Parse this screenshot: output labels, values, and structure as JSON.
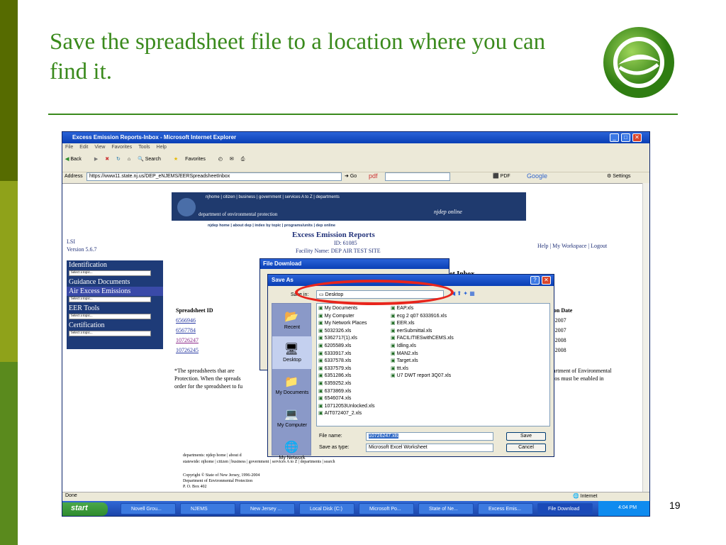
{
  "slide": {
    "title": "Save the spreadsheet file to a location where you can find it.",
    "number": "19"
  },
  "ie": {
    "title": "Excess Emission Reports-Inbox - Microsoft Internet Explorer",
    "menu": [
      "File",
      "Edit",
      "View",
      "Favorites",
      "Tools",
      "Help"
    ],
    "toolbar": {
      "back": "Back",
      "search": "Search",
      "favorites": "Favorites",
      "go": "Go",
      "pdf": "pdf",
      "pdf2": "PDF",
      "google": "Google",
      "settings": "Settings"
    },
    "address_label": "Address",
    "address": "https://www11.state.nj.us/DEP_eNJEMS/EERSpreadsheetInbox",
    "status": "Done",
    "zone": "Internet"
  },
  "taskbar": {
    "start": "start",
    "items": [
      "Novell Grou...",
      "NJEMS",
      "New Jersey ...",
      "Local Disk (C:)",
      "Microsoft Po...",
      "State of Ne...",
      "Excess Emis...",
      "File Download"
    ],
    "clock": "4:04 PM"
  },
  "page": {
    "banner_nav": "njhome  |  citizen  |  business  |  government  |  services A to Z  |  departments",
    "banner_dept": "department of environmental protection",
    "banner_brand": "njdep online",
    "banner_nav2": "njdep home  |  about dep  |  index by topic  |  programs/units  |  dep online",
    "heading": "Excess Emission Reports",
    "id": "ID: 61085",
    "facility": "Facility Name: DEP AIR TEST SITE",
    "lsi": "LSI",
    "version": "Version 5.6.7",
    "toplinks": "Help | My Workspace | Logout",
    "side": {
      "identification": "Identification",
      "guidance": "Guidance Documents",
      "air": "Air Excess Emissions",
      "eer": "EER Tools",
      "cert": "Certification",
      "select": "Select a topic..."
    },
    "col_spreadsheet": "Spreadsheet ID",
    "col_date": "tion Date",
    "ids": [
      "6566946",
      "6567784",
      "10726247",
      "10726245"
    ],
    "dates": [
      "0-2007",
      "0-2007",
      "8-2008",
      "8-2008"
    ],
    "inbox_frag": "et Inbox",
    "note1": "*The spreadsheets that are",
    "note2": "Protection. When the spreads",
    "note3": "order for the spreadsheet to fu",
    "note_r1": "partment of Environmental",
    "note_r2": "cros must be enabled in",
    "footer1": "departments: njdep home | about d",
    "footer2": "statewide: njhome | citizen | business | government | services A to Z | departments | search",
    "copyright1": "Copyright © State of New Jersey, 1996-2004",
    "copyright2": "Department of Environmental Protection",
    "copyright3": "P. O. Box 402"
  },
  "file_download": {
    "title": "File Download"
  },
  "save_as": {
    "title": "Save As",
    "save_in_label": "Save in:",
    "save_in": "Desktop",
    "places": [
      "Recent",
      "Desktop",
      "My Documents",
      "My Computer",
      "My Network"
    ],
    "col1": [
      "My Documents",
      "My Computer",
      "My Network Places",
      "5032326.xls",
      "5362717(1).xls",
      "6205589.xls",
      "6333917.xls",
      "6337578.xls",
      "6337579.xls",
      "6351286.xls",
      "6359252.xls",
      "6373869.xls",
      "6546074.xls",
      "10712053Unlocked.xls",
      "AIT072407_2.xls"
    ],
    "col2": [
      "EAP.xls",
      "ecg 2 q07 6333916.xls",
      "EER.xls",
      "eerSubmittal.xls",
      "FACILITIESwithCEMS.xls",
      "Idling.xls",
      "MAN2.xls",
      "Target.xls",
      "ttt.xls",
      "U7 DWT report 3Q07.xls"
    ],
    "filename_label": "File name:",
    "filename": "10726247.xls",
    "type_label": "Save as type:",
    "type": "Microsoft Excel Worksheet",
    "save": "Save",
    "cancel": "Cancel"
  }
}
